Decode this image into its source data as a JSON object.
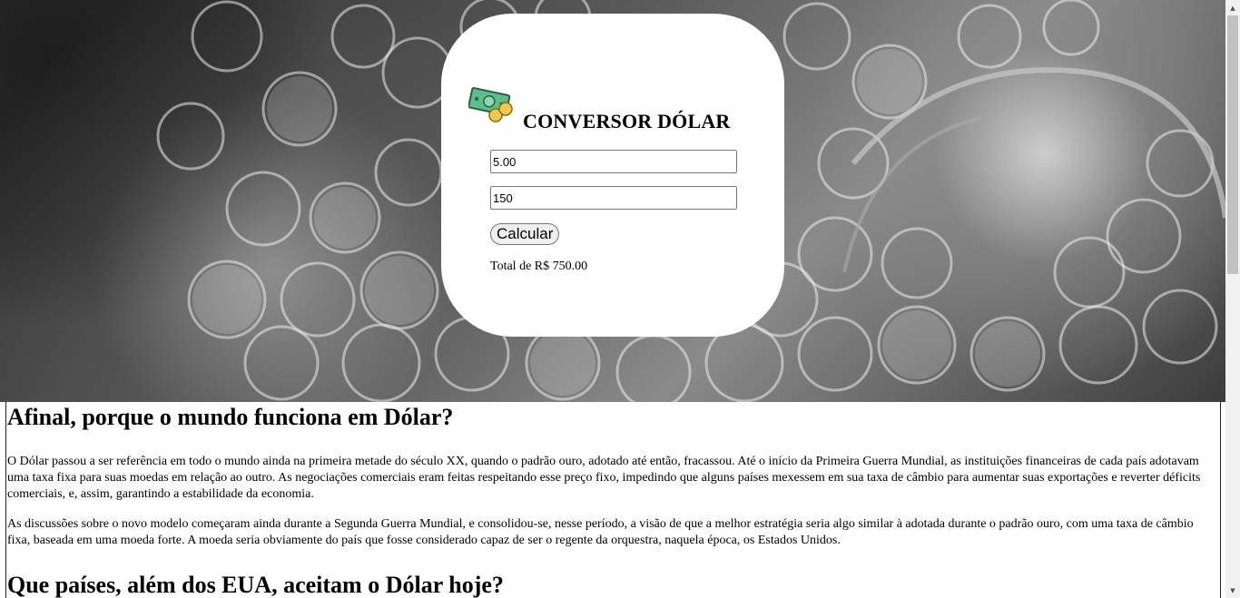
{
  "converter": {
    "title": "CONVERSOR DÓLAR",
    "icon": "money-cash-icon",
    "rate_value": "5.00",
    "amount_value": "150",
    "button_label": "Calcular",
    "total_text": "Total de R$ 750.00"
  },
  "article": {
    "heading_1": "Afinal, porque o mundo funciona em Dólar?",
    "paragraph_1": "O Dólar passou a ser referência em todo o mundo ainda na primeira metade do século XX, quando o padrão ouro, adotado até então, fracassou. Até o início da Primeira Guerra Mundial, as instituições financeiras de cada país adotavam uma taxa fixa para suas moedas em relação ao outro. As negociações comerciais eram feitas respeitando esse preço fixo, impedindo que alguns países mexessem em sua taxa de câmbio para aumentar suas exportações e reverter déficits comerciais, e, assim, garantindo a estabilidade da economia.",
    "paragraph_2": "As discussões sobre o novo modelo começaram ainda durante a Segunda Guerra Mundial, e consolidou-se, nesse período, a visão de que a melhor estratégia seria algo similar à adotada durante o padrão ouro, com uma taxa de câmbio fixa, baseada em uma moeda forte. A moeda seria obviamente do país que fosse considerado capaz de ser o regente da orquestra, naquela época, os Estados Unidos.",
    "heading_2": "Que países, além dos EUA, aceitam o Dólar hoje?"
  },
  "colors": {
    "card_background": "#ffffff",
    "note_green": "#5bbf8a",
    "coin_gold": "#f2c94c"
  }
}
